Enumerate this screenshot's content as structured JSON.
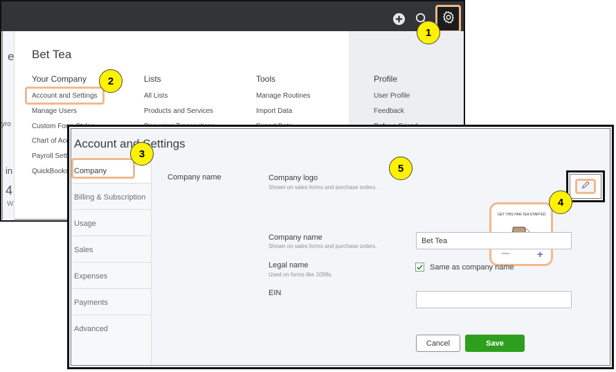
{
  "gear_menu": {
    "company_name": "Bet Tea",
    "left_sliver_text": "e",
    "left_sliver_fragments": [
      "yro",
      "in",
      "4",
      "W"
    ],
    "columns": [
      {
        "heading": "Your Company",
        "items": [
          "Account and Settings",
          "Manage Users",
          "Custom Form Styles",
          "Chart of Accounts",
          "Payroll Settings",
          "QuickBooks Labs"
        ]
      },
      {
        "heading": "Lists",
        "items": [
          "All Lists",
          "Products and Services",
          "Recurring Transactions"
        ]
      },
      {
        "heading": "Tools",
        "items": [
          "Manage Routines",
          "Import Data",
          "Export Data"
        ]
      },
      {
        "heading": "Profile",
        "items": [
          "User Profile",
          "Feedback",
          "Refer a Friend"
        ]
      }
    ]
  },
  "settings": {
    "title": "Account and Settings",
    "nav": [
      "Company",
      "Billing & Subscription",
      "Usage",
      "Sales",
      "Expenses",
      "Payments",
      "Advanced"
    ],
    "active_nav": "Company",
    "section_label": "Company name",
    "logo": {
      "label": "Company logo",
      "hint": "Shown on sales forms and purchase orders.",
      "image_text": "GET THIS PAR-TEA STARTED",
      "add_glyph": "+"
    },
    "company_name_field": {
      "label": "Company name",
      "hint": "Shown on sales forms and purchase orders.",
      "value": "Bet Tea"
    },
    "legal_name": {
      "label": "Legal name",
      "hint": "Used on forms like 1099s.",
      "checkbox_label": "Same as company name",
      "checked": true
    },
    "ein": {
      "label": "EIN",
      "value": ""
    },
    "buttons": {
      "cancel": "Cancel",
      "save": "Save"
    }
  },
  "callouts": [
    "1",
    "2",
    "3",
    "4",
    "5"
  ],
  "colors": {
    "topbar": "#333436",
    "highlight": "#f0b98e",
    "callout_fill": "#fff200",
    "save_green": "#2ca01c"
  }
}
